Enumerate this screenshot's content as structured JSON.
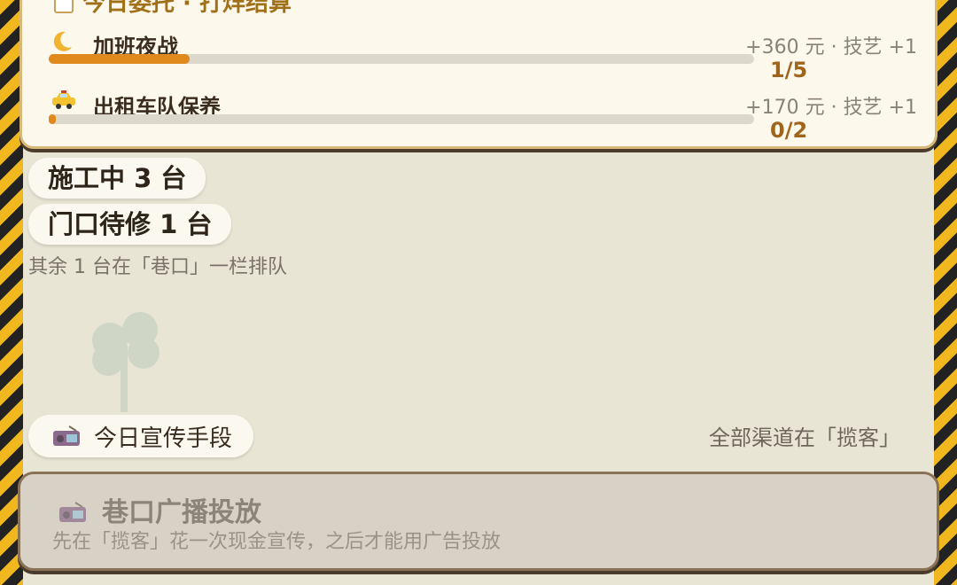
{
  "commission": {
    "title": "今日委托 · 打烊结算",
    "tasks": [
      {
        "icon": "moon-icon",
        "name": "加班夜战",
        "reward": "+360 元 · 技艺 +1",
        "count": "1/5",
        "progress": 0.2
      },
      {
        "icon": "taxi-icon",
        "name": "出租车队保养",
        "reward": "+170 元 · 技艺 +1",
        "count": "0/2",
        "progress": 0.0
      }
    ]
  },
  "status": {
    "in_progress": "施工中 3 台",
    "waiting": "门口待修 1 台",
    "queue_note": "其余 1 台在「巷口」一栏排队"
  },
  "promo": {
    "label": "今日宣传手段",
    "channel_note": "全部渠道在「揽客」"
  },
  "broadcast": {
    "title": "巷口广播投放",
    "description": "先在「揽客」花一次现金宣传，之后才能用广告投放"
  },
  "colors": {
    "accent": "#e08a1e",
    "hazard_yellow": "#f0b81e",
    "card_border": "#d9b97a"
  }
}
